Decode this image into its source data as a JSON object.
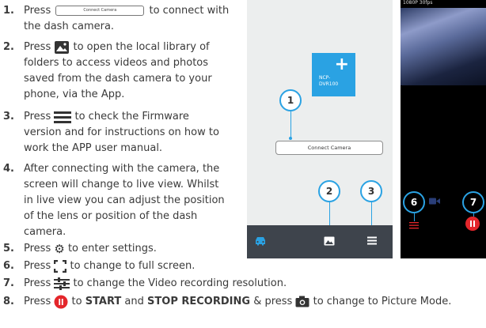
{
  "steps": [
    {
      "num": "1.",
      "lines": [
        {
          "pre": "Press",
          "post": "to connect with"
        },
        {
          "text": "the dash camera."
        }
      ]
    },
    {
      "num": "2.",
      "lines": [
        {
          "pre": "Press",
          "post": "to open the local library of"
        },
        {
          "text": "folders to access videos and photos"
        },
        {
          "text": "saved from the dash camera to your"
        },
        {
          "text": "phone, via the App."
        }
      ]
    },
    {
      "num": "3.",
      "lines": [
        {
          "pre": "Press",
          "post": "to check the Firmware"
        },
        {
          "text": "version and for instructions on how to"
        },
        {
          "text": "work the APP user manual."
        }
      ]
    },
    {
      "num": "4.",
      "lines": [
        {
          "text": "After connecting with the camera, the"
        },
        {
          "text": "screen will change to live view. Whilst"
        },
        {
          "text": "in live view you can adjust the position"
        },
        {
          "text": "of the lens or position of the dash"
        },
        {
          "text": "camera."
        }
      ]
    },
    {
      "num": "5.",
      "lines": [
        {
          "pre": "Press",
          "post": "to enter settings."
        }
      ]
    },
    {
      "num": "6.",
      "lines": [
        {
          "pre": "Press",
          "post": "to change to full screen."
        }
      ]
    },
    {
      "num": "7.",
      "lines": [
        {
          "pre": "Press",
          "post": "to change the Video recording resolution."
        }
      ]
    },
    {
      "num": "8.",
      "lines": [
        {
          "pre": "Press",
          "post1": "to",
          "bold1": "START",
          "mid": "and",
          "bold2": "STOP RECORDING",
          "post2": "& press",
          "post3": "to change to Picture Mode."
        }
      ]
    }
  ],
  "inline_button_label": "Connect Camera",
  "phone1": {
    "card_plus": "+",
    "card_name_1": "NCP-",
    "card_name_2": "DVR100",
    "connect_button": "Connect Camera",
    "callouts": [
      "1",
      "2",
      "3"
    ],
    "nav_icons": [
      "car-icon",
      "gallery-icon",
      "menu-icon"
    ]
  },
  "phone2": {
    "resolution": "1080P 30fps",
    "callouts": [
      "6",
      "7"
    ],
    "icons": [
      "resolution-sliders-icon",
      "video-camera-icon",
      "record-button-icon"
    ]
  },
  "colors": {
    "accent": "#2aa2e3",
    "nav_bar": "#3e444c",
    "record": "#e4262b"
  }
}
